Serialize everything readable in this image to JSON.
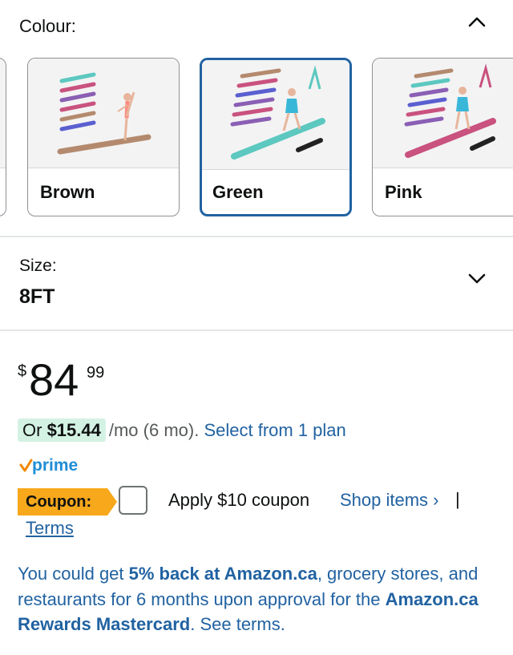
{
  "colour": {
    "label": "Colour:",
    "options": [
      {
        "name": "Brown",
        "selected": false,
        "beam_color": "#b48a6e"
      },
      {
        "name": "Green",
        "selected": true,
        "beam_color": "#5cc8c0"
      },
      {
        "name": "Pink",
        "selected": false,
        "beam_color": "#c9527e"
      }
    ]
  },
  "size": {
    "label": "Size:",
    "value": "8FT"
  },
  "price": {
    "symbol": "$",
    "whole": "84",
    "fraction": "99"
  },
  "monthly": {
    "amount_prefix": "Or ",
    "amount": "$15.44",
    "term": "/mo (6 mo).",
    "link": "Select from 1 plan"
  },
  "prime": {
    "label": "prime",
    "check_color": "#f08804",
    "text_color": "#1f8dd6"
  },
  "coupon": {
    "tag": "Coupon:",
    "text": "Apply $10 coupon",
    "shop_link": "Shop items ›",
    "separator": "|",
    "terms": "Terms"
  },
  "rewards": {
    "part1": "You could get ",
    "bold1": "5% back at Amazon.ca",
    "part2": ", grocery stores, and restaurants for 6 months upon approval for the ",
    "bold2": "Amazon.ca Rewards Mastercard",
    "part3": ". See terms."
  },
  "colors": {
    "link": "#2162a1",
    "selected_border": "#2162a1",
    "coupon_badge": "#f7a81b",
    "monthly_highlight": "#d4f2e4"
  }
}
